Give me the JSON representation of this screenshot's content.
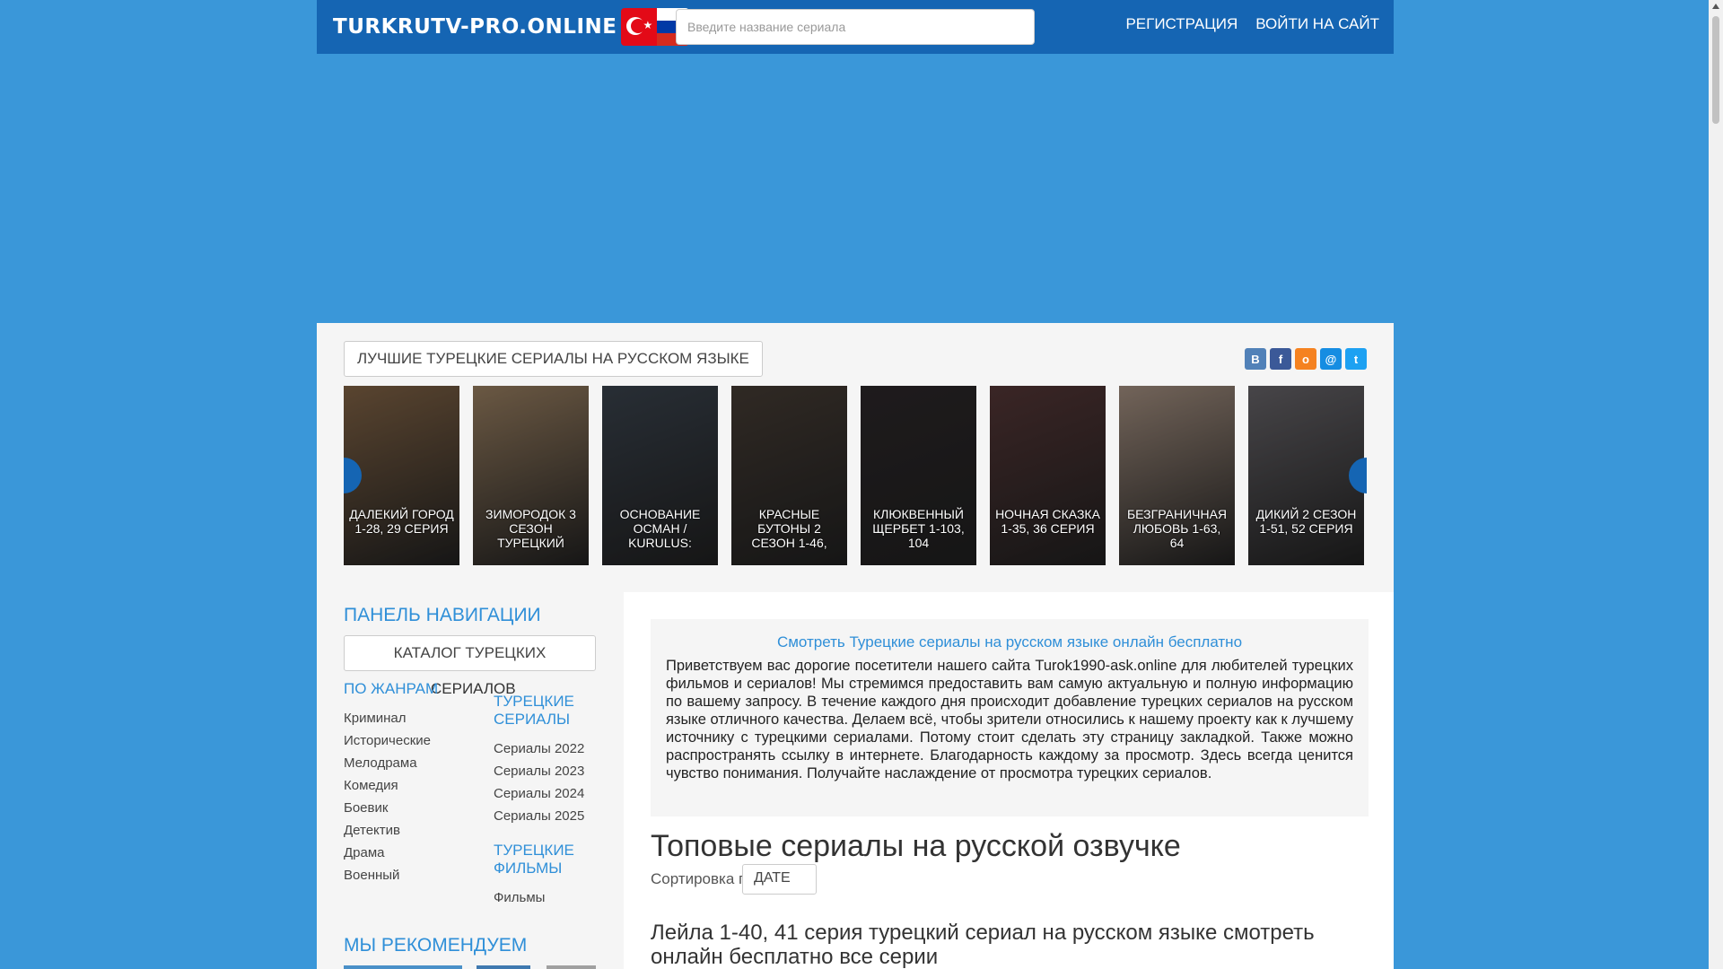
{
  "header": {
    "logo_text": "TURKRUTV-PRO.ONLINE",
    "search_placeholder": "Введите название сериала",
    "register_label": "РЕГИСТРАЦИЯ",
    "login_label": "ВОЙТИ НА САЙТ"
  },
  "slider": {
    "title": "ЛУЧШИЕ ТУРЕЦКИЕ СЕРИАЛЫ НА РУССКОМ ЯЗЫКЕ",
    "social": [
      "vk-icon",
      "facebook-icon",
      "odnoklassniki-icon",
      "mailru-icon",
      "twitter-icon"
    ],
    "cards": [
      {
        "title": "ДАЛЕКИЙ ГОРОД 1-28, 29 СЕРИЯ",
        "color": "#8a6a4a"
      },
      {
        "title": "ЗИМОРОДОК 3 СЕЗОН ТУРЕЦКИЙ",
        "color": "#a48868"
      },
      {
        "title": "ОСНОВАНИЕ ОСМАН / KURULUS:",
        "color": "#3e4752"
      },
      {
        "title": "КРАСНЫЕ БУТОНЫ 2 СЕЗОН 1-46,",
        "color": "#4a4038"
      },
      {
        "title": "КЛЮКВЕННЫЙ ЩЕРБЕТ 1-103, 104",
        "color": "#2f2a2c"
      },
      {
        "title": "НОЧНАЯ СКАЗКА 1-35, 36 СЕРИЯ",
        "color": "#5a3a3a"
      },
      {
        "title": "БЕЗГРАНИЧНАЯ ЛЮБОВЬ 1-63, 64",
        "color": "#b09a8a"
      },
      {
        "title": "ДИКИЙ 2 СЕЗОН 1-51, 52 СЕРИЯ",
        "color": "#6e6b70"
      }
    ]
  },
  "sidebar": {
    "nav_heading": "ПАНЕЛЬ НАВИГАЦИИ",
    "catalog_label": "КАТАЛОГ ТУРЕЦКИХ",
    "catalog_label2": "СЕРИАЛОВ",
    "genres_heading": "ПО ЖАНРАМ",
    "genres": [
      "Криминал",
      "Исторические",
      "Мелодрама",
      "Комедия",
      "Боевик",
      "Детектив",
      "Драма",
      "Военный"
    ],
    "series_heading": "ТУРЕЦКИЕ СЕРИАЛЫ",
    "series": [
      "Сериалы 2022",
      "Сериалы 2023",
      "Сериалы 2024",
      "Сериалы 2025"
    ],
    "films_heading": "ТУРЕЦКИЕ ФИЛЬМЫ",
    "films": [
      "Фильмы"
    ],
    "recommend_heading": "МЫ РЕКОМЕНДУЕМ"
  },
  "main": {
    "intro_title": "Смотреть Турецкие сериалы на русском языке онлайн бесплатно",
    "intro_text": "Приветствуем вас дорогие посетители нашего сайта Turok1990-ask.online для любителей турецких фильмов и сериалов! Мы стремимся предоставить вам самую актуальную и полную информацию по вашему запросу. В течение каждого дня происходит добавление турецких сериалов на русском языке отличного качества. Делаем всё, чтобы зрители относились к нашему проекту как к лучшему источнику с турецкими сериалами. Потому стоит сделать эту страницу закладкой. Также можно распространять ссылку в интернете. Благодарность каждому за просмотр. Здесь всегда ценится чувство понимания. Получайте наслаждение от просмотра турецких сериалов.",
    "top_heading": "Топовые сериалы на русской озвучке",
    "sort_label": "Сортировка по",
    "sort_value": "ДАТЕ",
    "first_item_title": "Лейла 1-40, 41 серия турецкий сериал на русском языке смотреть онлайн бесплатно все серии"
  }
}
